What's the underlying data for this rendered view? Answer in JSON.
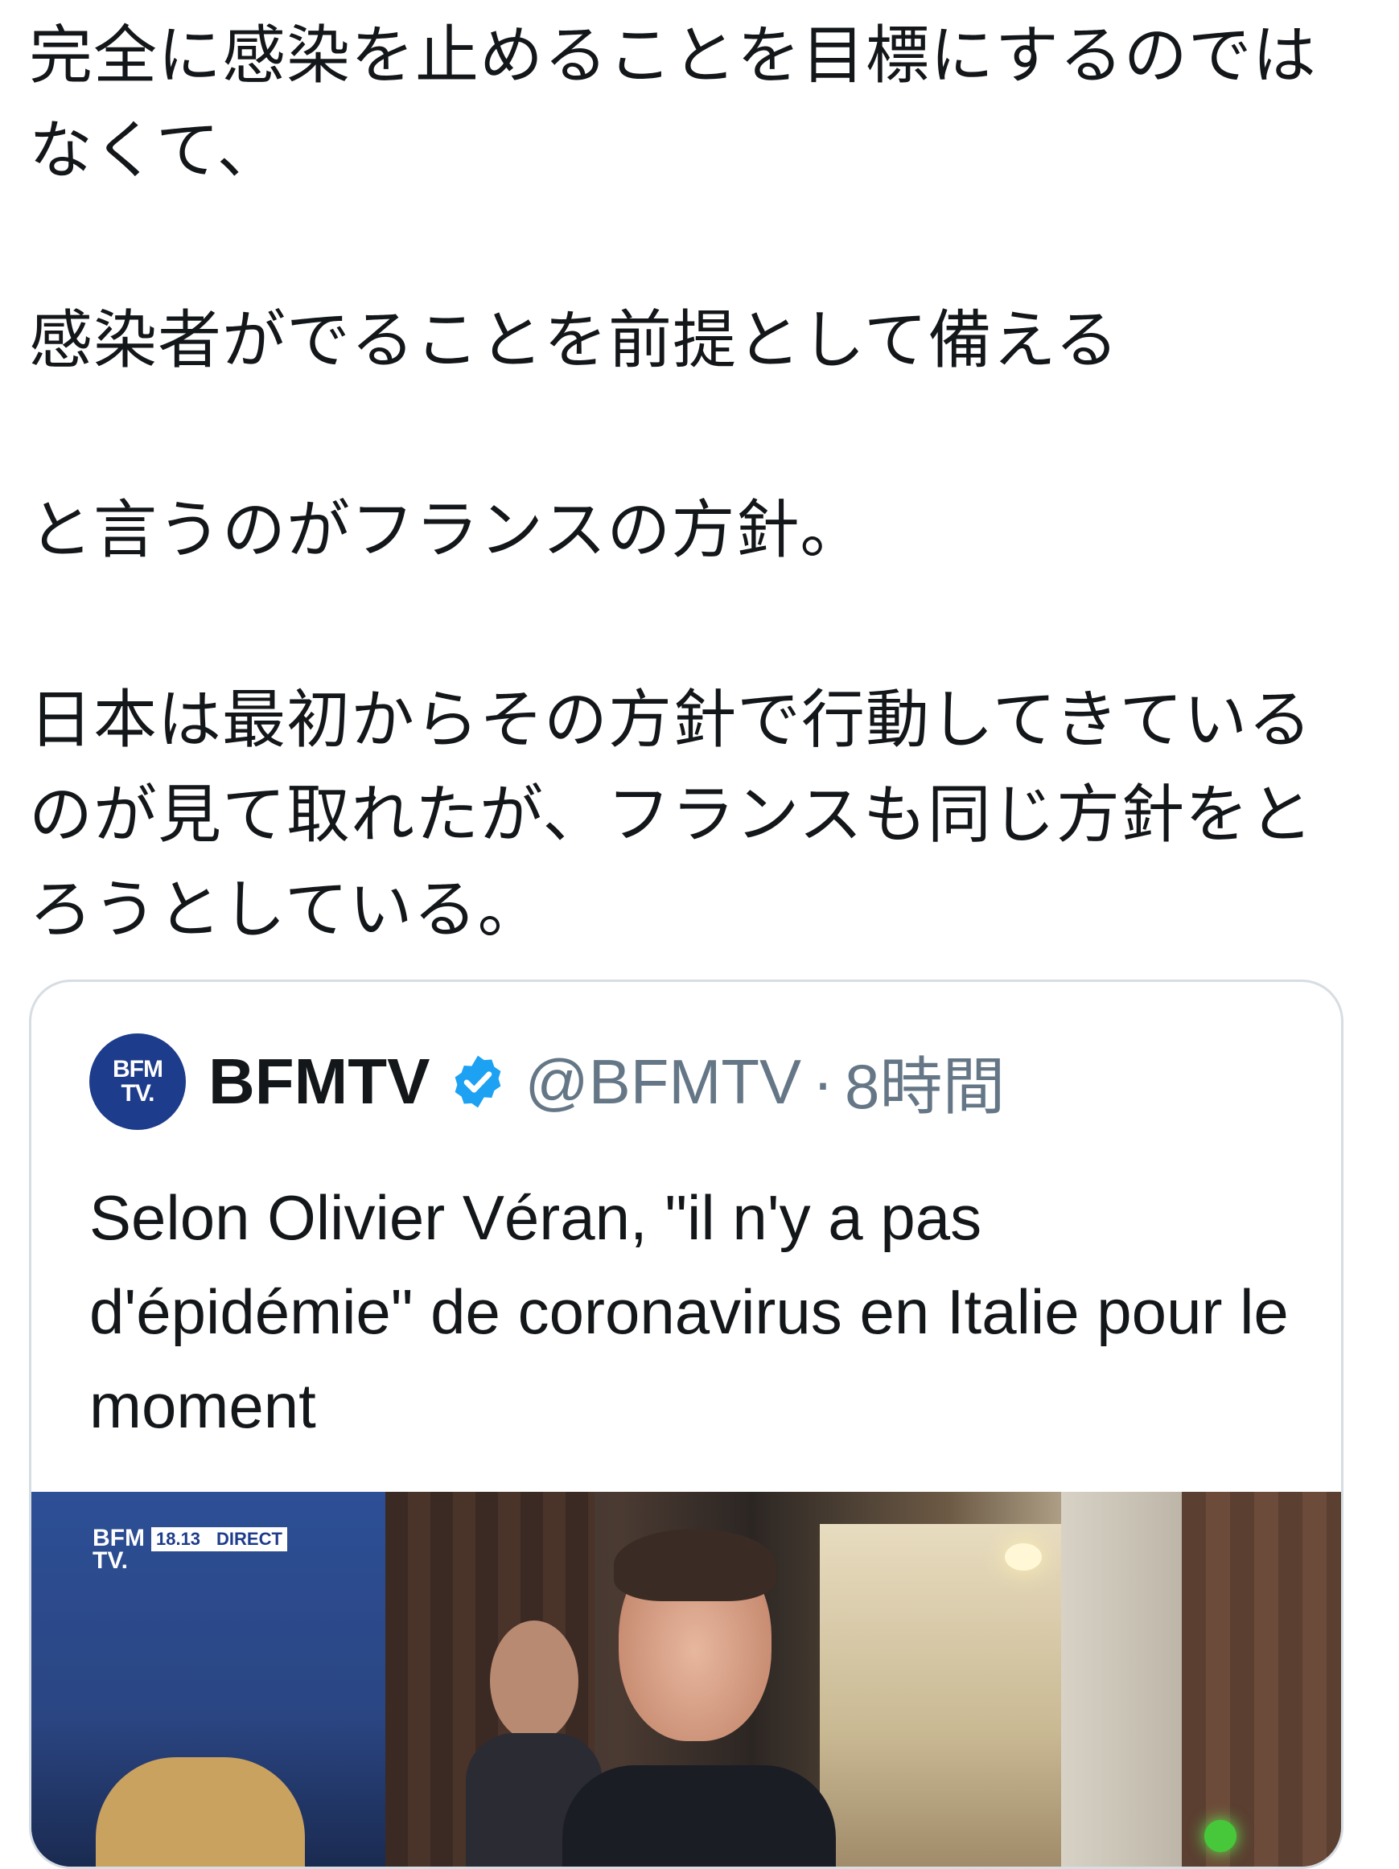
{
  "tweet": {
    "paragraphs": [
      "完全に感染を止めることを目標にするのではなくて、",
      "感染者がでることを前提として備える",
      "と言うのがフランスの方針。",
      "日本は最初からその方針で行動してきているのが見て取れたが、フランスも同じ方針をとろうとしている。"
    ]
  },
  "quoted_tweet": {
    "avatar_line1": "BFM",
    "avatar_line2": "TV.",
    "display_name": "BFMTV",
    "handle": "@BFMTV",
    "separator": "·",
    "time": "8時間",
    "text": "Selon Olivier Véran, \"il n'y a pas d'épidémie\" de coronavirus en Italie pour le moment",
    "media": {
      "logo_line1": "BFM",
      "logo_line2": "TV.",
      "clock": "18.13",
      "live_label": "DIRECT"
    }
  },
  "colors": {
    "text": "#14171a",
    "secondary": "#657786",
    "verified": "#1da1f2",
    "brand": "#1e3c8c",
    "border": "#d6dde3"
  },
  "icons": {
    "verified": "verified-badge-icon"
  }
}
